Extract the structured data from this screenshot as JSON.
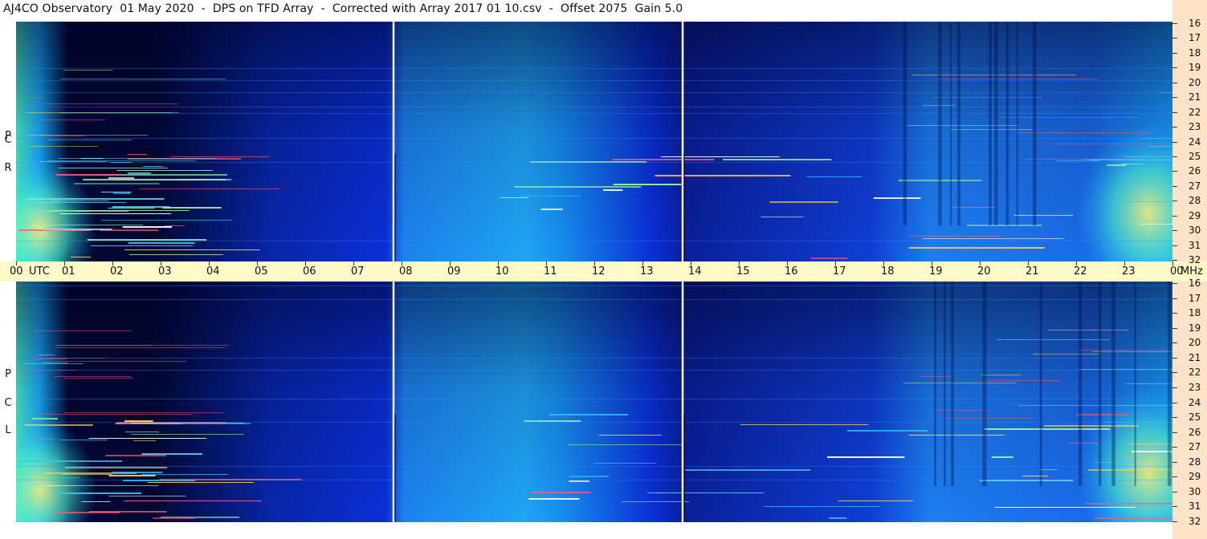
{
  "header": {
    "title": "AJ4CO Observatory  01 May 2020  -  DPS on TFD Array  -  Corrected with Array 2017 01 10.csv  -  Offset 2075  Gain 5.0"
  },
  "time_axis": {
    "labels": [
      "00",
      "01",
      "02",
      "03",
      "04",
      "05",
      "06",
      "07",
      "08",
      "09",
      "10",
      "11",
      "12",
      "13",
      "14",
      "15",
      "16",
      "17",
      "18",
      "19",
      "20",
      "21",
      "22",
      "23",
      "00"
    ],
    "utc_label": "UTC",
    "mhz_label": "MHz"
  },
  "panels": [
    {
      "letters": [
        "P",
        "C",
        "R"
      ]
    },
    {
      "letters": [
        "P",
        "C",
        "L"
      ]
    }
  ],
  "freq_axis": {
    "labels": [
      "32",
      "31",
      "30",
      "29",
      "28",
      "27",
      "26",
      "25",
      "24",
      "23",
      "22",
      "21",
      "20",
      "19",
      "18",
      "17",
      "16"
    ]
  },
  "colors": {
    "background": "#ffffff",
    "time_axis_bg": "#fffac8",
    "freq_axis_bg": "#ffe3c8",
    "spectrum_dark": "#000833",
    "spectrum_mid": "#0a2fd8",
    "spectrum_light": "#1ab0ff",
    "spectrum_bright": "#4df0c8",
    "spectrum_hot": "#f5f07a"
  },
  "chart_data": {
    "type": "heatmap",
    "title": "AJ4CO Observatory  01 May 2020  -  DPS on TFD Array  -  Corrected with Array 2017 01 10.csv  -  Offset 2075  Gain 5.0",
    "x_unit": "UTC",
    "y_unit": "MHz",
    "xlim": [
      0,
      24
    ],
    "ylim": [
      16,
      32
    ],
    "x_ticks": [
      0,
      1,
      2,
      3,
      4,
      5,
      6,
      7,
      8,
      9,
      10,
      11,
      12,
      13,
      14,
      15,
      16,
      17,
      18,
      19,
      20,
      21,
      22,
      23,
      24
    ],
    "y_ticks": [
      16,
      17,
      18,
      19,
      20,
      21,
      22,
      23,
      24,
      25,
      26,
      27,
      28,
      29,
      30,
      31,
      32
    ],
    "panels": [
      "RCP",
      "LCP"
    ],
    "vertical_markers_utc": [
      7.83,
      13.83
    ],
    "grid": false
  }
}
